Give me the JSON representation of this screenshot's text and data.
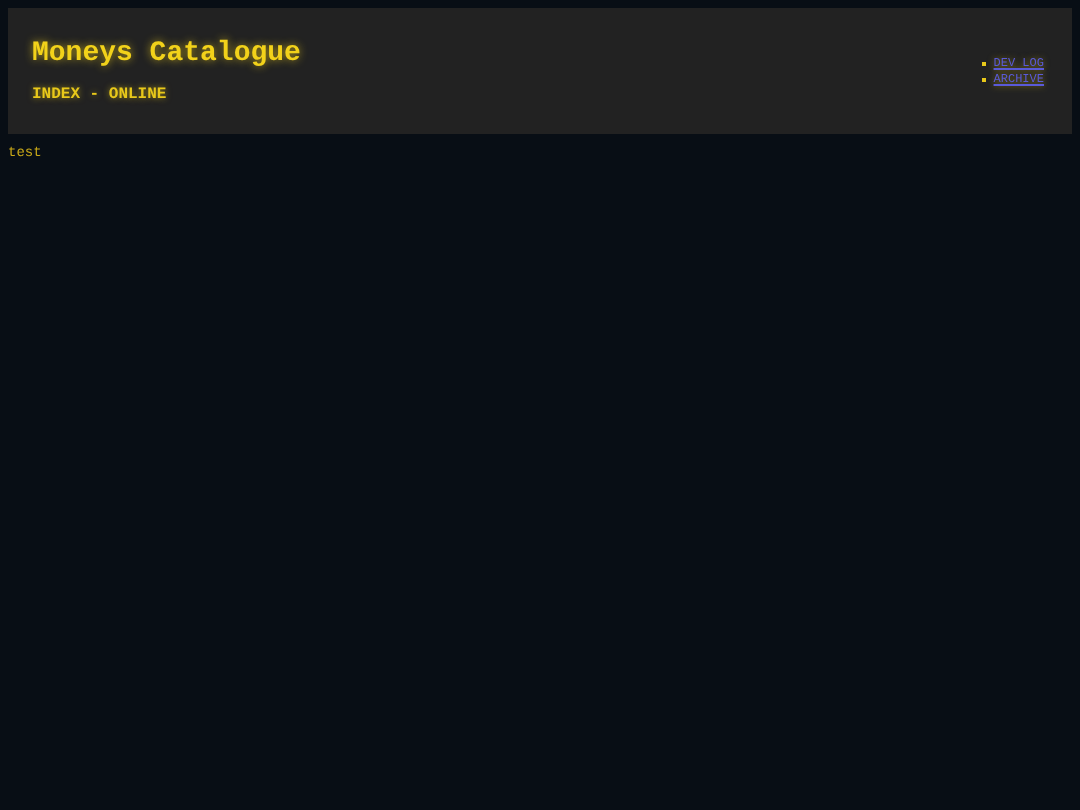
{
  "header": {
    "title": "Moneys Catalogue",
    "subtitle": "INDEX - ONLINE",
    "links": [
      "DEV LOG",
      "ARCHIVE"
    ]
  },
  "body": {
    "text": "test"
  }
}
